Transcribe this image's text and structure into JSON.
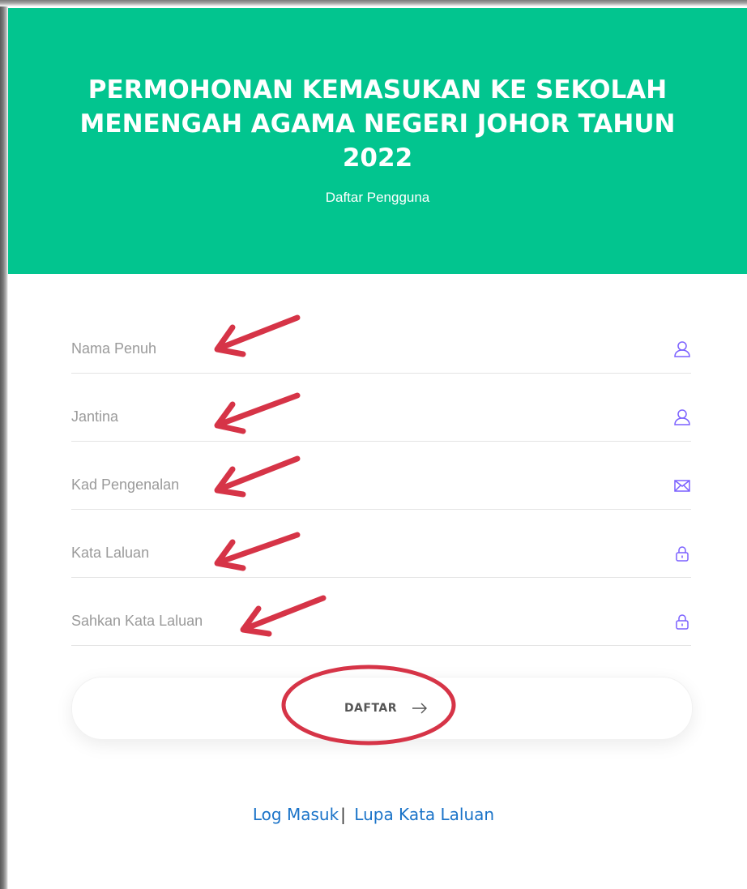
{
  "header": {
    "title": "PERMOHONAN KEMASUKAN KE SEKOLAH MENENGAH AGAMA NEGERI JOHOR TAHUN 2022",
    "subtitle": "Daftar Pengguna",
    "bg_color": "#02c58f"
  },
  "form": {
    "fields": [
      {
        "placeholder": "Nama Penuh",
        "value": "",
        "icon": "user-icon"
      },
      {
        "placeholder": "Jantina",
        "value": "",
        "icon": "user-icon"
      },
      {
        "placeholder": "Kad Pengenalan",
        "value": "",
        "icon": "envelope-icon"
      },
      {
        "placeholder": "Kata Laluan",
        "value": "",
        "icon": "lock-icon"
      },
      {
        "placeholder": "Sahkan Kata Laluan",
        "value": "",
        "icon": "lock-icon"
      }
    ],
    "submit_label": "DAFTAR",
    "icon_color": "#7b61ff"
  },
  "links": {
    "login": "Log Masuk",
    "separator": "|",
    "forgot": "Lupa Kata Laluan",
    "color": "#1a73c8"
  },
  "annotations": {
    "arrow_color": "#d63447",
    "circle_color": "#d63447"
  }
}
